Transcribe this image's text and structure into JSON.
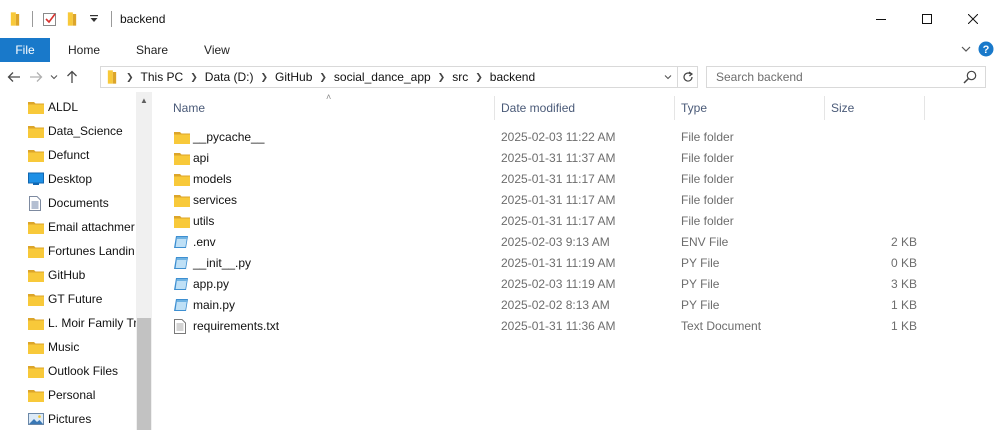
{
  "window": {
    "title": "backend"
  },
  "ribbon": {
    "tabs": [
      "File",
      "Home",
      "Share",
      "View"
    ]
  },
  "address": {
    "crumbs": [
      "This PC",
      "Data (D:)",
      "GitHub",
      "social_dance_app",
      "src",
      "backend"
    ]
  },
  "search": {
    "placeholder": "Search backend"
  },
  "navpane": {
    "items": [
      {
        "label": "ALDL",
        "icon": "folder-icon"
      },
      {
        "label": "Data_Science",
        "icon": "folder-icon"
      },
      {
        "label": "Defunct",
        "icon": "folder-icon"
      },
      {
        "label": "Desktop",
        "icon": "desktop-icon"
      },
      {
        "label": "Documents",
        "icon": "documents-icon"
      },
      {
        "label": "Email attachmer",
        "icon": "folder-icon"
      },
      {
        "label": "Fortunes Landin",
        "icon": "folder-icon"
      },
      {
        "label": "GitHub",
        "icon": "folder-icon"
      },
      {
        "label": "GT Future",
        "icon": "folder-icon"
      },
      {
        "label": "L. Moir Family Tr",
        "icon": "folder-icon"
      },
      {
        "label": "Music",
        "icon": "folder-icon"
      },
      {
        "label": "Outlook Files",
        "icon": "folder-icon"
      },
      {
        "label": "Personal",
        "icon": "folder-icon"
      },
      {
        "label": "Pictures",
        "icon": "pictures-icon"
      }
    ]
  },
  "columns": {
    "name": "Name",
    "date": "Date modified",
    "type": "Type",
    "size": "Size"
  },
  "files": [
    {
      "name": "__pycache__",
      "date": "2025-02-03 11:22 AM",
      "type": "File folder",
      "size": "",
      "icon": "folder-icon"
    },
    {
      "name": "api",
      "date": "2025-01-31 11:37 AM",
      "type": "File folder",
      "size": "",
      "icon": "folder-icon"
    },
    {
      "name": "models",
      "date": "2025-01-31 11:17 AM",
      "type": "File folder",
      "size": "",
      "icon": "folder-icon"
    },
    {
      "name": "services",
      "date": "2025-01-31 11:17 AM",
      "type": "File folder",
      "size": "",
      "icon": "folder-icon"
    },
    {
      "name": "utils",
      "date": "2025-01-31 11:17 AM",
      "type": "File folder",
      "size": "",
      "icon": "folder-icon"
    },
    {
      "name": ".env",
      "date": "2025-02-03 9:13 AM",
      "type": "ENV File",
      "size": "2 KB",
      "icon": "script-file-icon"
    },
    {
      "name": "__init__.py",
      "date": "2025-01-31 11:19 AM",
      "type": "PY File",
      "size": "0 KB",
      "icon": "script-file-icon"
    },
    {
      "name": "app.py",
      "date": "2025-02-03 11:19 AM",
      "type": "PY File",
      "size": "3 KB",
      "icon": "script-file-icon"
    },
    {
      "name": "main.py",
      "date": "2025-02-02 8:13 AM",
      "type": "PY File",
      "size": "1 KB",
      "icon": "script-file-icon"
    },
    {
      "name": "requirements.txt",
      "date": "2025-01-31 11:36 AM",
      "type": "Text Document",
      "size": "1 KB",
      "icon": "text-file-icon"
    }
  ],
  "colors": {
    "accent": "#1979ca",
    "folder": "#f8c93a",
    "folder_dark": "#dca52a"
  }
}
